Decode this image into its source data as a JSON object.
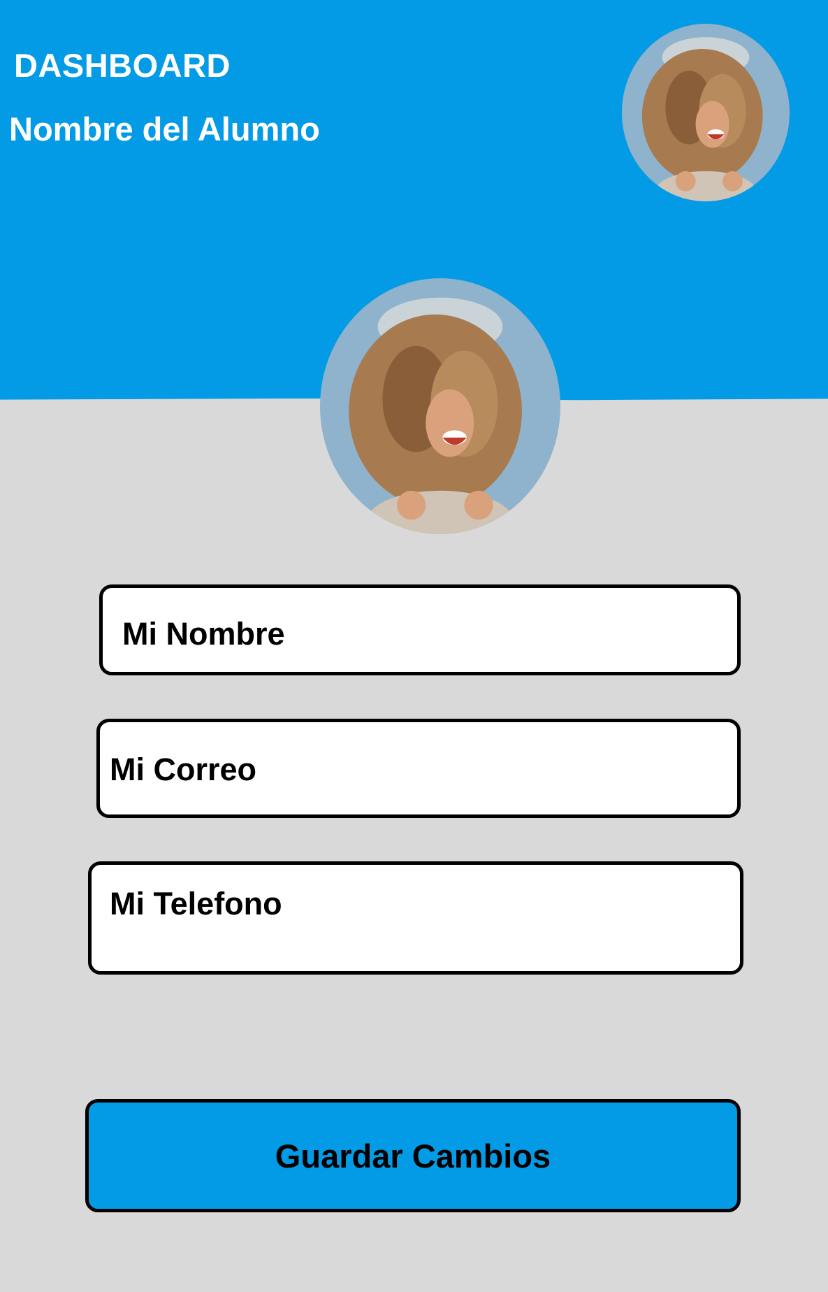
{
  "header": {
    "title": "DASHBOARD",
    "student_name": "Nombre del Alumno"
  },
  "colors": {
    "accent": "#039be5",
    "background": "#d9d9d9",
    "field_bg": "#ffffff",
    "border": "#000000"
  },
  "form": {
    "name_field": "Mi Nombre",
    "email_field": "Mi Correo",
    "phone_field": "Mi Telefono",
    "save_label": "Guardar Cambios"
  },
  "icons": {
    "avatar": "profile-photo-avatar"
  }
}
